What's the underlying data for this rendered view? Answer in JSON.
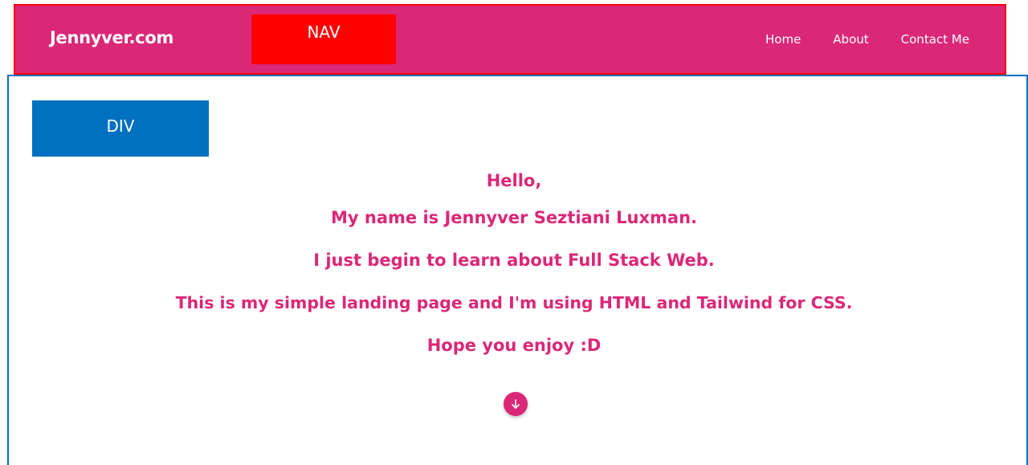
{
  "navbar": {
    "brand": "Jennyver.com",
    "label": "NAV",
    "links": [
      {
        "label": "Home"
      },
      {
        "label": "About"
      },
      {
        "label": "Contact Me"
      }
    ],
    "background_color": "#db2777",
    "outline_color": "#ff0000"
  },
  "content": {
    "label": "DIV",
    "outline_color": "#0070c0",
    "lines": [
      "Hello,",
      "My name is Jennyver Seztiani Luxman.",
      "I just begin to learn about Full Stack Web.",
      "This is my simple landing page and I'm using HTML and Tailwind for CSS.",
      "Hope you enjoy :D"
    ],
    "text_color": "#db2777",
    "scroll_button_icon": "arrow-down-icon"
  }
}
